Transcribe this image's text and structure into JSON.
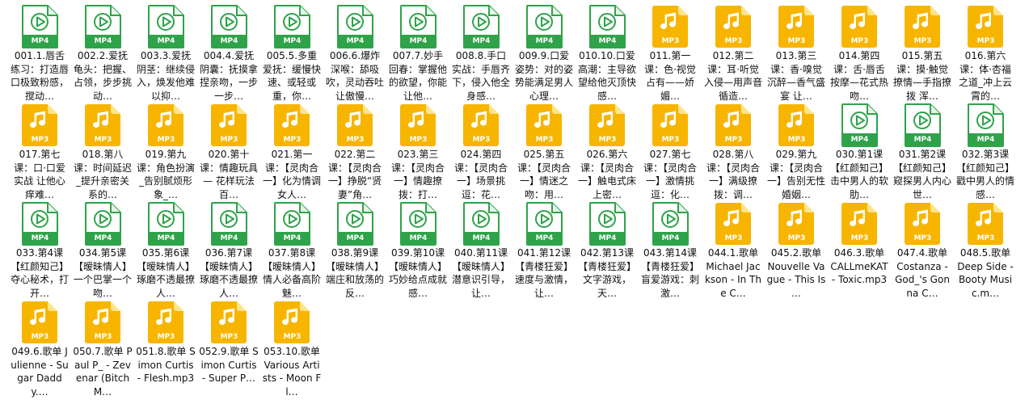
{
  "colors": {
    "mp4_green": "#2fa34a",
    "mp3_yellow": "#f7b500",
    "mp3_fold": "#ffe58a",
    "text": "#111111"
  },
  "icons": {
    "mp4": "mp4-video-file-icon",
    "mp3": "mp3-audio-file-icon"
  },
  "files": [
    {
      "type": "MP4",
      "badge": "MP4",
      "name": "001.1.唇舌练习：打造唇口极致粉感，搅动…"
    },
    {
      "type": "MP4",
      "badge": "MP4",
      "name": "002.2.爱抚龟头：把握、占领，步步挑动…"
    },
    {
      "type": "MP4",
      "badge": "MP4",
      "name": "003.3.爱抚阴茎：继续侵入，焕发他难以抑…"
    },
    {
      "type": "MP4",
      "badge": "MP4",
      "name": "004.4.爱抚阴囊：抚摸拿捏亲吻，一步一步…"
    },
    {
      "type": "MP4",
      "badge": "MP4",
      "name": "005.5.多重爱抚：缓慢快速、或轻或重，你…"
    },
    {
      "type": "MP4",
      "badge": "MP4",
      "name": "006.6.爆炸深喉：舔吸吹，灵动吞吐让傲慢…"
    },
    {
      "type": "MP4",
      "badge": "MP4",
      "name": "007.7.妙手回春：掌握他的欲望，你能让他…"
    },
    {
      "type": "MP4",
      "badge": "MP4",
      "name": "008.8.手口实战：手唇齐下，侵入他全身感…"
    },
    {
      "type": "MP4",
      "badge": "MP4",
      "name": "009.9.口爱姿势：对的姿势能满足男人心理…"
    },
    {
      "type": "MP4",
      "badge": "MP4",
      "name": "010.10.口爱高潮：主导欲望给他灭顶快感…"
    },
    {
      "type": "MP3",
      "badge": "MP3",
      "name": "011.第一课：色·视觉占有——娇媚…"
    },
    {
      "type": "MP3",
      "badge": "MP3",
      "name": "012.第二课：耳·听觉入侵—用声音循造…"
    },
    {
      "type": "MP3",
      "badge": "MP3",
      "name": "013.第三课：香·嗅觉沉醉—香气盛宴 让…"
    },
    {
      "type": "MP3",
      "badge": "MP3",
      "name": "014.第四课：舌·唇舌按摩—花式热吻…"
    },
    {
      "type": "MP3",
      "badge": "MP3",
      "name": "015.第五课：摸·触觉撩情—手指撩拨 浑…"
    },
    {
      "type": "MP3",
      "badge": "MP3",
      "name": "016.第六课：体·杏福之道_冲上云霄的…"
    },
    {
      "type": "MP3",
      "badge": "MP3",
      "name": "017.第七课：口·口爱实战 让他心痒难…"
    },
    {
      "type": "MP3",
      "badge": "MP3",
      "name": "018.第八课：时间延迟_提升亲密关系的…"
    },
    {
      "type": "MP3",
      "badge": "MP3",
      "name": "019.第九课：角色扮演_告别腻烦形象_…"
    },
    {
      "type": "MP3",
      "badge": "MP3",
      "name": "020.第十课：情趣玩具— 花样玩法 百…"
    },
    {
      "type": "MP3",
      "badge": "MP3",
      "name": "021.第一课：【灵肉合一】化为情调女人…"
    },
    {
      "type": "MP3",
      "badge": "MP3",
      "name": "022.第二课：【灵肉合一】挣脱“贤妻”角…"
    },
    {
      "type": "MP3",
      "badge": "MP3",
      "name": "023.第三课：【灵肉合一】情趣撩拨：打…"
    },
    {
      "type": "MP3",
      "badge": "MP3",
      "name": "024.第四课：【灵肉合一】场景挑逗：花…"
    },
    {
      "type": "MP3",
      "badge": "MP3",
      "name": "025.第五课：【灵肉合一】情迷之吻：用…"
    },
    {
      "type": "MP3",
      "badge": "MP3",
      "name": "026.第六课：【灵肉合一】触电式床上密…"
    },
    {
      "type": "MP3",
      "badge": "MP3",
      "name": "027.第七课：【灵肉合一】激情挑逗：化…"
    },
    {
      "type": "MP3",
      "badge": "MP3",
      "name": "028.第八课：【灵肉合一】满级撩拨：调…"
    },
    {
      "type": "MP3",
      "badge": "MP3",
      "name": "029.第九课：【灵肉合一】告别无性婚姻…"
    },
    {
      "type": "MP4",
      "badge": "MP4",
      "name": "030.第1课【红颜知己】击中男人的软肋…"
    },
    {
      "type": "MP4",
      "badge": "MP4",
      "name": "031.第2课【红颜知己】窥探男人内心世…"
    },
    {
      "type": "MP4",
      "badge": "MP4",
      "name": "032.第3课【红颜知己】戳中男人的情感…"
    },
    {
      "type": "MP4",
      "badge": "MP4",
      "name": "033.第4课【红颜知己】夺心秘术，打开…"
    },
    {
      "type": "MP4",
      "badge": "MP4",
      "name": "034.第5课【暧昧情人】一个巴掌一个吻…"
    },
    {
      "type": "MP4",
      "badge": "MP4",
      "name": "035.第6课【暧昧情人】琢磨不透最撩人…"
    },
    {
      "type": "MP4",
      "badge": "MP4",
      "name": "036.第7课【暧昧情人】琢磨不透最撩人…"
    },
    {
      "type": "MP4",
      "badge": "MP4",
      "name": "037.第8课【暧昧情人】情人必备高阶魅…"
    },
    {
      "type": "MP4",
      "badge": "MP4",
      "name": "038.第9课【暧昧情人】端庄和放荡的反…"
    },
    {
      "type": "MP4",
      "badge": "MP4",
      "name": "039.第10课【暧昧情人】巧妙给点成就感…"
    },
    {
      "type": "MP4",
      "badge": "MP4",
      "name": "040.第11课【暧昧情人】潜意识引导，让…"
    },
    {
      "type": "MP4",
      "badge": "MP4",
      "name": "041.第12课【青楼狂爱】速度与激情，让…"
    },
    {
      "type": "MP4",
      "badge": "MP4",
      "name": "042.第13课 【青楼狂爱】文字游戏，天…"
    },
    {
      "type": "MP4",
      "badge": "MP4",
      "name": "043.第14课【青楼狂爱】盲爱游戏：刺激…"
    },
    {
      "type": "MP3",
      "badge": "MP3",
      "name": "044.1.歌单 Michael Jackson - In The C…"
    },
    {
      "type": "MP3",
      "badge": "MP3",
      "name": "045.2.歌单 Nouvelle Vague - This Is …"
    },
    {
      "type": "MP3",
      "badge": "MP3",
      "name": "046.3.歌单 CALLmeKAT - Toxic.mp3"
    },
    {
      "type": "MP3",
      "badge": "MP3",
      "name": "047.4.歌单 Costanza - God_'s Gonna C…"
    },
    {
      "type": "MP3",
      "badge": "MP3",
      "name": "048.5.歌单 Deep Side - Booty Music.m…"
    },
    {
      "type": "MP3",
      "badge": "MP3",
      "name": "049.6.歌单 Julienne - Sugar Daddy.…"
    },
    {
      "type": "MP3",
      "badge": "MP3",
      "name": "050.7.歌单 Paul P_ - Zevenar (Bitch M…"
    },
    {
      "type": "MP3",
      "badge": "MP3",
      "name": "051.8.歌单 Simon Curtis - Flesh.mp3"
    },
    {
      "type": "MP3",
      "badge": "MP3",
      "name": "052.9.歌单 Simon Curtis - Super P…"
    },
    {
      "type": "MP3",
      "badge": "MP3",
      "name": "053.10.歌单 Various Artists - Moon Fl…"
    }
  ]
}
